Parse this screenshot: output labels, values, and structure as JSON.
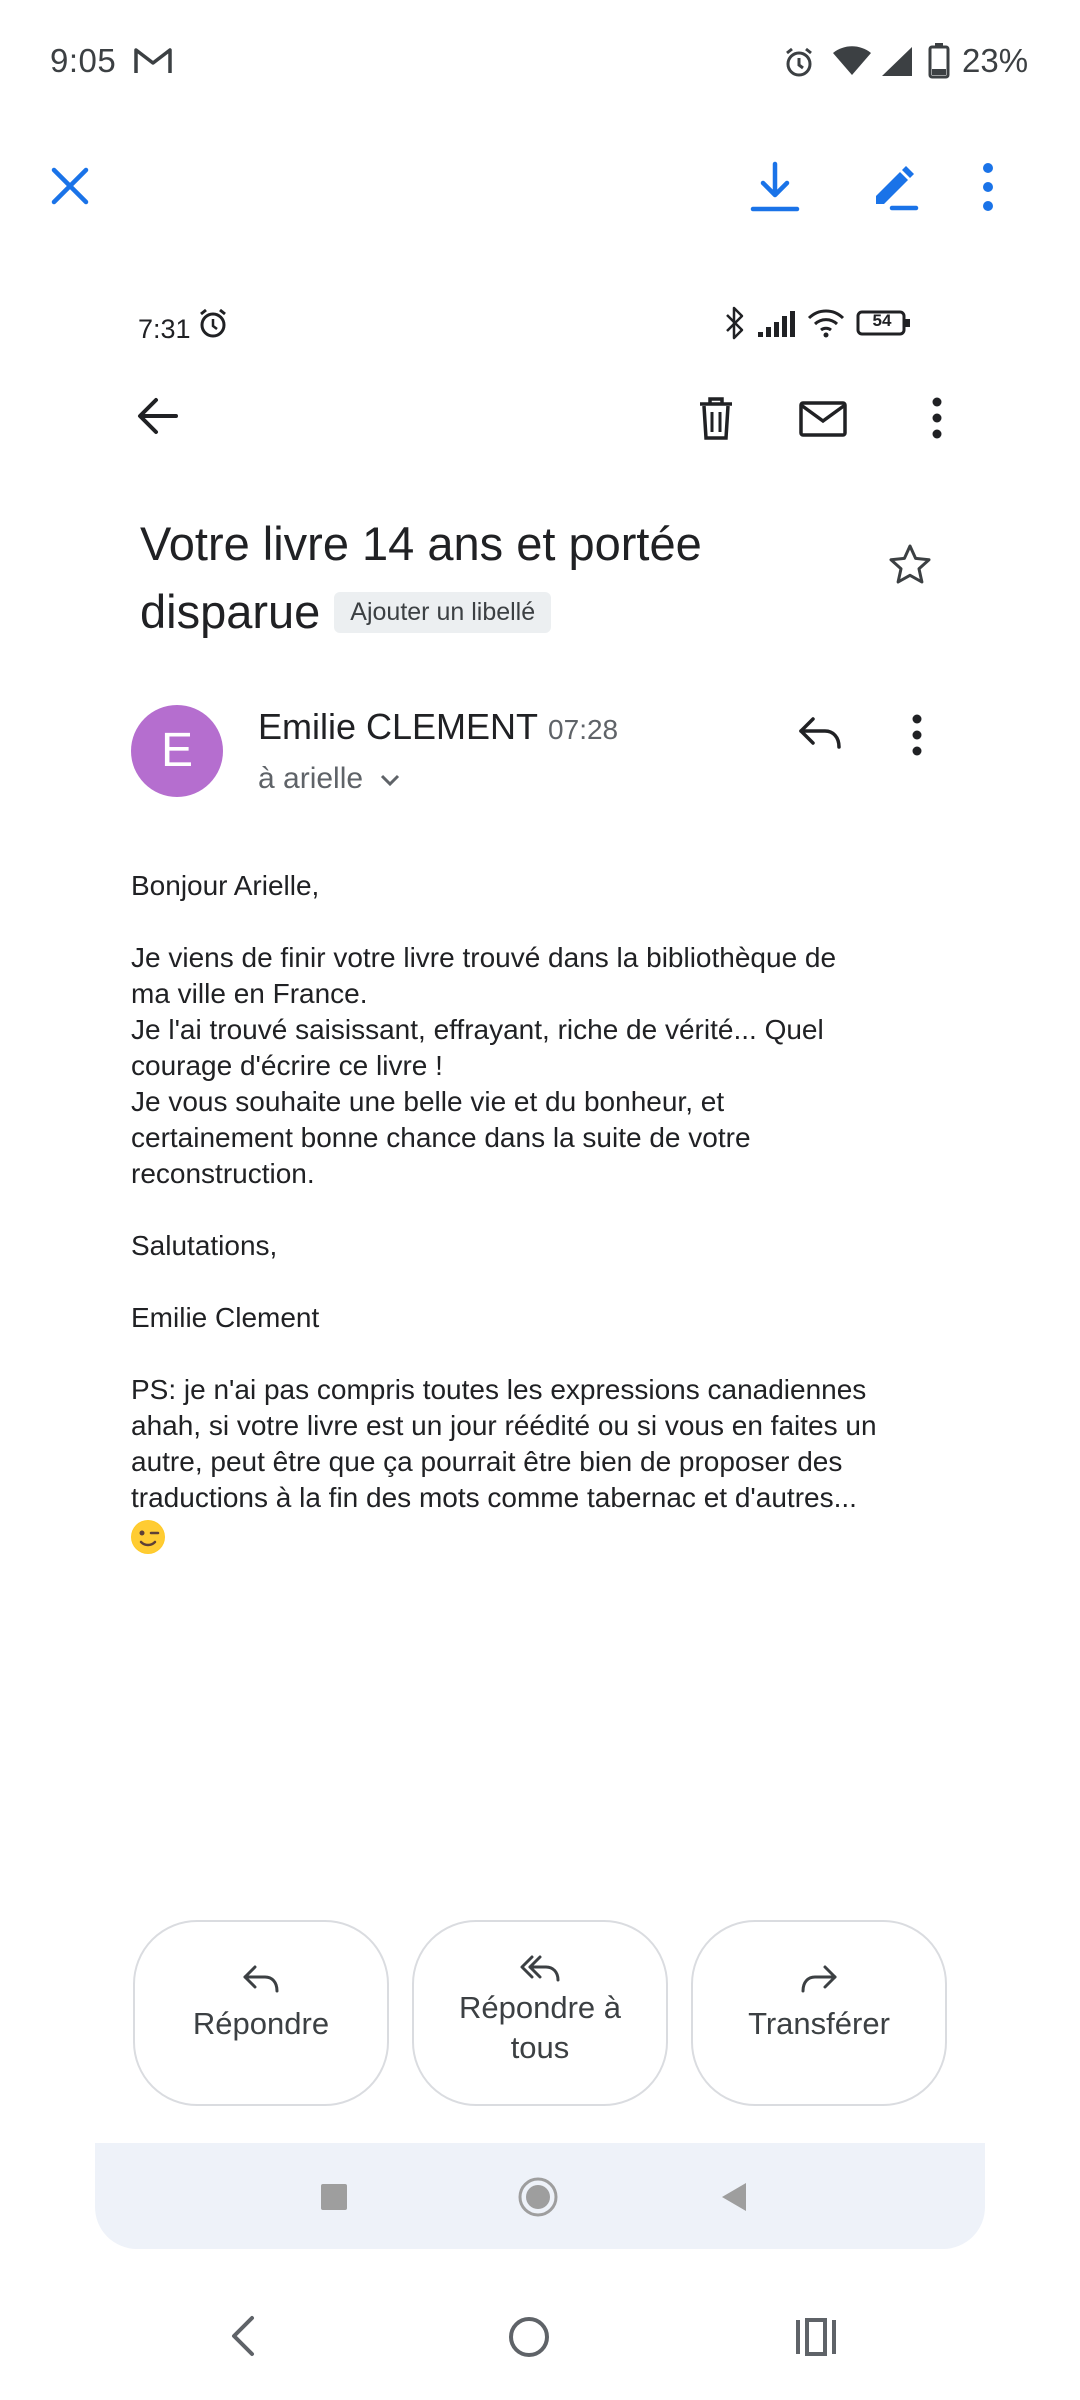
{
  "status_bar": {
    "time": "9:05",
    "battery": "23%",
    "icons": [
      "gmail-icon",
      "alarm-icon",
      "wifi-icon",
      "signal-icon",
      "battery-icon"
    ]
  },
  "viewer": {
    "accent": "#1a73e8",
    "icons": [
      "close-icon",
      "download-icon",
      "edit-icon",
      "more-icon"
    ]
  },
  "inner": {
    "status_time": "7:31",
    "battery_level": "54",
    "subject_line1": "Votre livre 14 ans et portée",
    "subject_line2": "disparue",
    "label": "Ajouter un libellé",
    "sender": {
      "initial": "E",
      "name": "Emilie CLEMENT",
      "time": "07:28",
      "to": "à arielle",
      "avatar_color": "#b56ecf"
    },
    "body": {
      "greeting": "Bonjour Arielle,",
      "p1": [
        "Je viens de finir votre livre trouvé dans la bibliothèque de",
        "ma ville en France.",
        "Je l'ai trouvé saisissant, effrayant, riche de vérité... Quel",
        "courage d'écrire ce livre !",
        "Je vous souhaite une belle vie et du bonheur, et",
        "certainement bonne chance dans la suite de votre",
        "reconstruction."
      ],
      "closing": "Salutations,",
      "signature": "Emilie Clement",
      "ps": [
        "PS: je n'ai pas compris toutes les expressions canadiennes",
        "ahah, si votre livre est un jour réédité ou si vous en faites un",
        "autre, peut être que ça pourrait être bien de proposer des",
        "traductions à la fin des mots comme tabernac et d'autres..."
      ]
    },
    "actions": {
      "reply": "Répondre",
      "reply_all_line1": "Répondre à",
      "reply_all_line2": "tous",
      "forward": "Transférer"
    }
  }
}
